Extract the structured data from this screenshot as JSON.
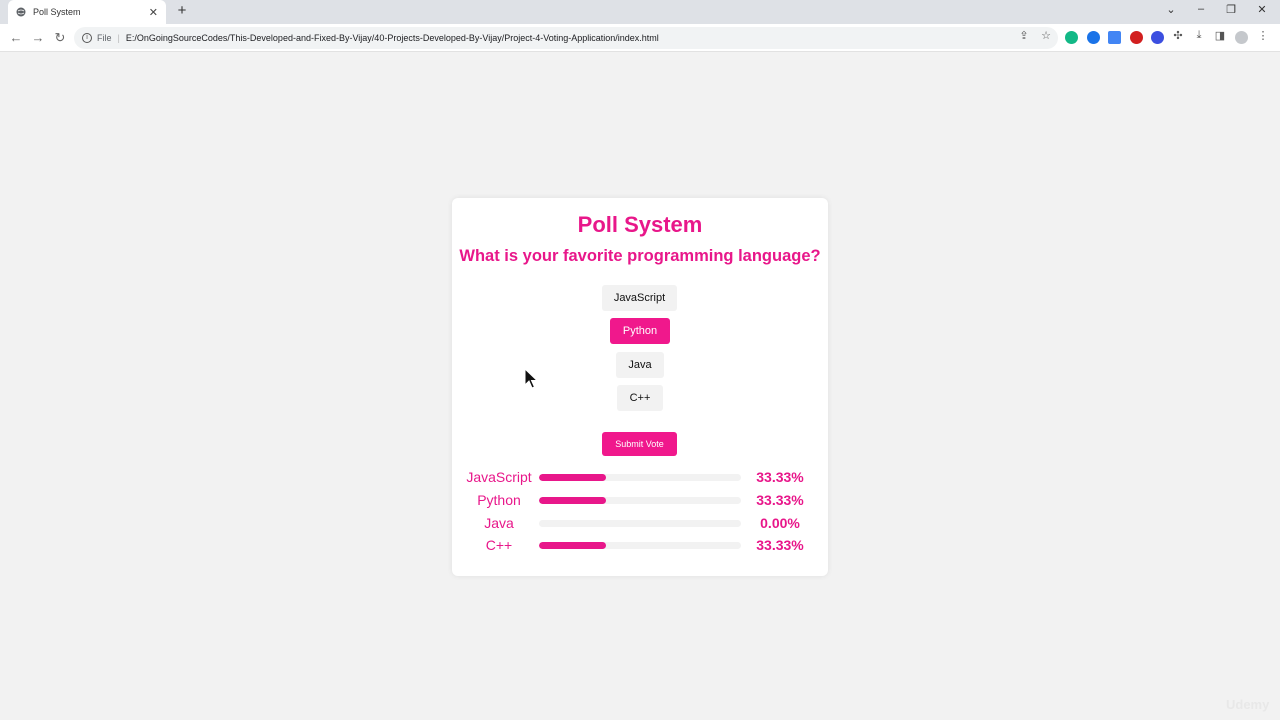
{
  "browser": {
    "tab_title": "Poll System",
    "new_tab": "+",
    "url_scheme": "File",
    "url": "E:/OnGoingSourceCodes/This-Developed-and-Fixed-By-Vijay/40-Projects-Developed-By-Vijay/Project-4-Voting-Application/index.html"
  },
  "poll": {
    "title": "Poll System",
    "question": "What is your favorite programming language?",
    "options": [
      "JavaScript",
      "Python",
      "Java",
      "C++"
    ],
    "selected_option": "Python",
    "submit_label": "Submit Vote"
  },
  "results": [
    {
      "label": "JavaScript",
      "percent": 33.33,
      "percent_text": "33.33%"
    },
    {
      "label": "Python",
      "percent": 33.33,
      "percent_text": "33.33%"
    },
    {
      "label": "Java",
      "percent": 0,
      "percent_text": "0.00%"
    },
    {
      "label": "C++",
      "percent": 33.33,
      "percent_text": "33.33%"
    }
  ],
  "colors": {
    "accent": "#e8178a",
    "button": "#f0188c",
    "page_bg": "#f2f2f2"
  },
  "watermark": "Udemy"
}
